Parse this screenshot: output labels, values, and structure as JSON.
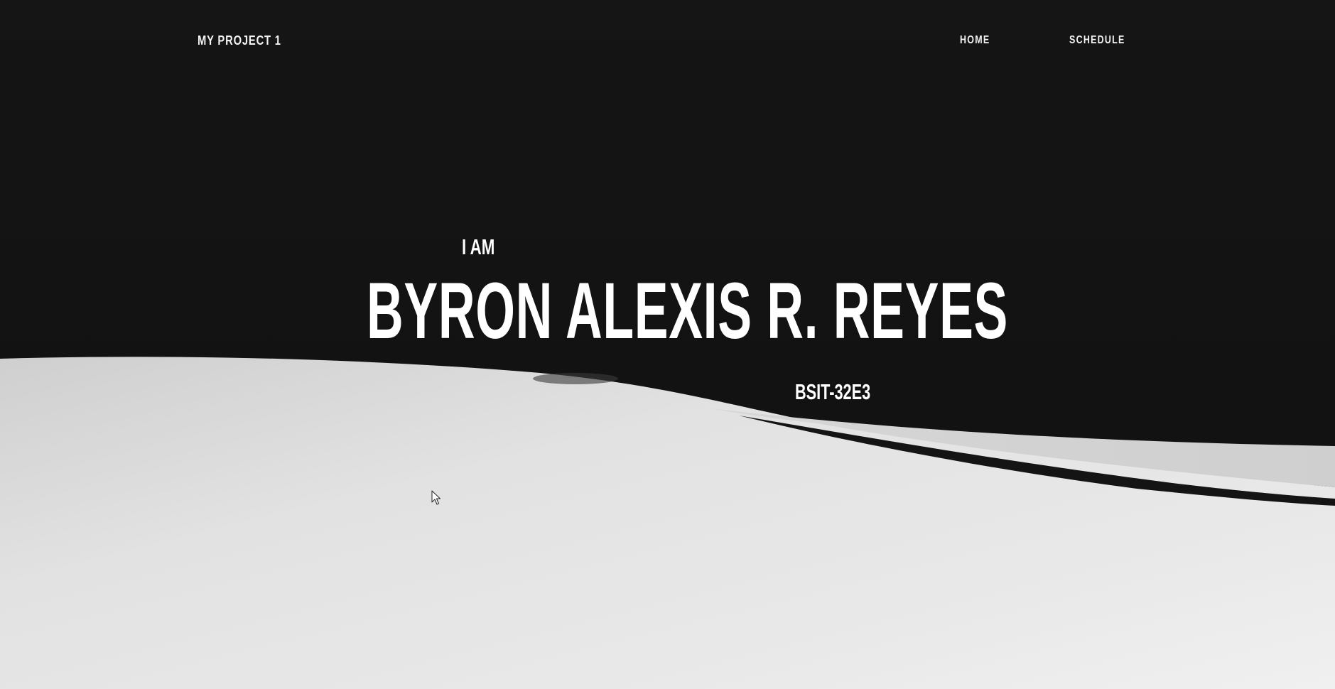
{
  "header": {
    "brand": "MY PROJECT 1",
    "nav": [
      {
        "label": "HOME"
      },
      {
        "label": "SCHEDULE"
      }
    ]
  },
  "hero": {
    "intro": "I AM",
    "name": "BYRON ALEXIS R. REYES",
    "section": "BSIT-32E3"
  },
  "colors": {
    "dark_background": "#141414",
    "light_background": "#e6e6e6",
    "text": "#ffffff"
  },
  "icons": {
    "cursor": "mouse-pointer-icon"
  }
}
